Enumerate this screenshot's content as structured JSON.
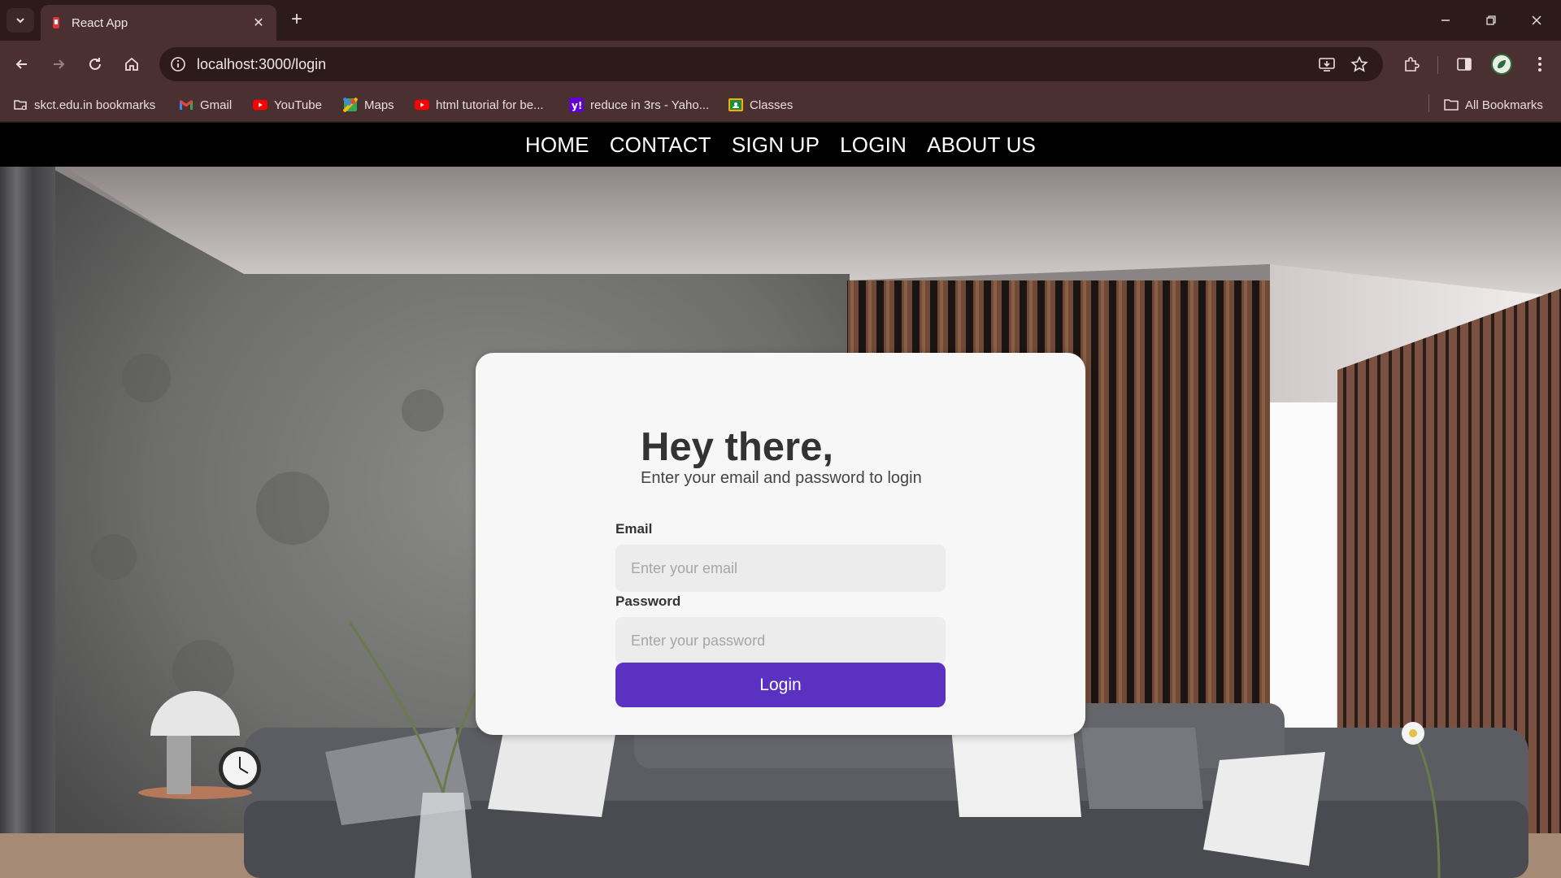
{
  "browser": {
    "tab": {
      "title": "React App"
    },
    "address": {
      "url": "localhost:3000/login"
    },
    "bookmarks": [
      {
        "label": "skct.edu.in bookmarks",
        "icon": "folder-icon"
      },
      {
        "label": "Gmail",
        "icon": "gmail-icon"
      },
      {
        "label": "YouTube",
        "icon": "youtube-icon"
      },
      {
        "label": "Maps",
        "icon": "maps-icon"
      },
      {
        "label": "html tutorial for be...",
        "icon": "youtube-icon"
      },
      {
        "label": "reduce in 3rs - Yaho...",
        "icon": "yahoo-icon"
      },
      {
        "label": "Classes",
        "icon": "classroom-icon"
      }
    ],
    "all_bookmarks": "All Bookmarks",
    "colors": {
      "frame": "#2d1b1b",
      "toolbar": "#4a3030"
    }
  },
  "nav": {
    "links": [
      "HOME",
      "CONTACT",
      "SIGN UP",
      "LOGIN",
      "ABOUT US"
    ]
  },
  "login": {
    "heading": "Hey there,",
    "subtitle": "Enter your email and password to login",
    "email_label": "Email",
    "email_placeholder": "Enter your email",
    "password_label": "Password",
    "password_placeholder": "Enter your password",
    "button": "Login",
    "accent": "#5a31c0"
  }
}
